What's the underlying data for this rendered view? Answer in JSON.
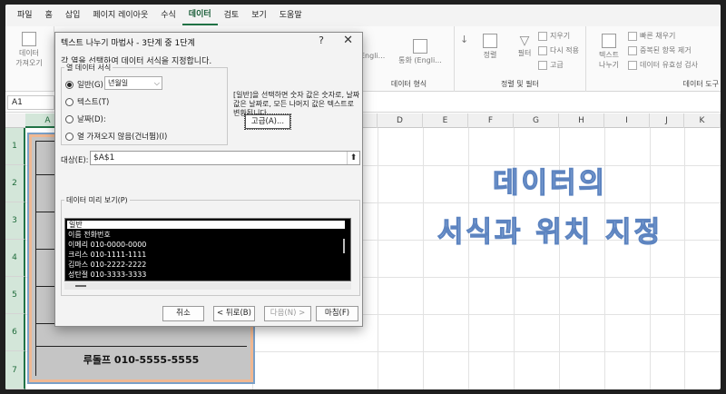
{
  "ribbon_tabs": [
    "파일",
    "홈",
    "삽입",
    "페이지 레이아웃",
    "수식",
    "데이터",
    "검토",
    "보기",
    "도움말"
  ],
  "active_tab": "데이터",
  "ribbon": {
    "get_data_line1": "데이터",
    "get_data_line2": "가져오기",
    "stocks": "Engli...",
    "currency": "통화 (Engli...",
    "data_types_label": "데이터 형식",
    "sort_label": "정렬",
    "filter_label": "필터",
    "clear": "지우기",
    "reapply": "다시 적용",
    "advanced": "고급",
    "sort_filter_label": "정렬 및 필터",
    "text_to_columns_line1": "텍스트",
    "text_to_columns_line2": "나누기",
    "flash_fill": "빠른 채우기",
    "remove_duplicates": "중복된 항목 제거",
    "data_validation": "데이터 유효성 검사",
    "data_tools_label": "데이터 도구"
  },
  "name_box": "A1",
  "columns": [
    "A",
    "B",
    "C",
    "D",
    "E",
    "F",
    "G",
    "H",
    "I",
    "J",
    "K"
  ],
  "rows": [
    "1",
    "2",
    "3",
    "4",
    "5",
    "6",
    "7"
  ],
  "cell_block": {
    "last_row_text": "루돌프 010-5555-5555"
  },
  "annotation": {
    "line1": "데이터의",
    "line2": "서식과 위치 지정"
  },
  "dialog": {
    "title": "텍스트 나누기 마법사 - 3단계 중 1단계",
    "help": "?",
    "close": "✕",
    "description": "각 열을 선택하여 데이터 서식을 지정합니다.",
    "format_group_label": "열 데이터 서식",
    "options": {
      "general": "일반(G)",
      "text": "텍스트(T)",
      "date": "날짜(D):",
      "skip": "열 가져오지 않음(건너뜀)(I)"
    },
    "date_format_value": "년월일",
    "info_text": "[일반]을 선택하면 숫자 값은 숫자로, 날짜 값은 날짜로, 모든 나머지 값은 텍스트로 변환됩니다.",
    "advanced_button": "고급(A)...",
    "destination_label": "대상(E):",
    "destination_value": "$A$1",
    "preview_label": "데이터 미리 보기(P)",
    "preview_header": "일반",
    "preview_rows": [
      "이름 전화번호",
      "이메리 010-0000-0000",
      "크리스 010-1111-1111",
      "김마스 010-2222-2222",
      "성탄절 010-3333-3333"
    ],
    "cancel": "취소",
    "back": "< 뒤로(B)",
    "next": "다음(N) >",
    "finish": "마침(F)"
  }
}
